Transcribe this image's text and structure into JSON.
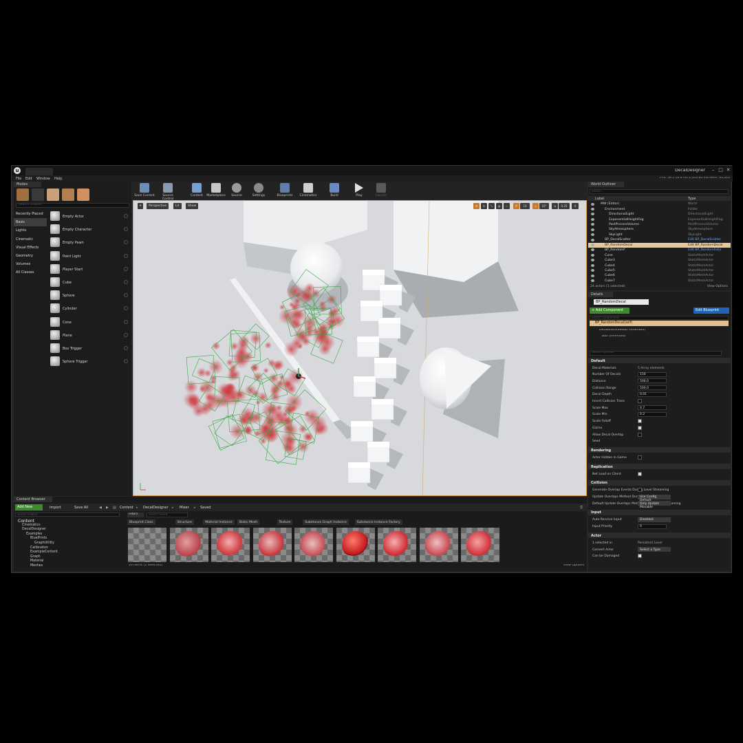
{
  "app": {
    "project_name": "DecalDesigner",
    "menu": [
      "File",
      "Edit",
      "Window",
      "Help"
    ],
    "stats": "FPS: 59.5    16.9 ms    2,103.84 mb    Mem: 93,343"
  },
  "modes": {
    "tab": "Modes",
    "search_placeholder": "Search Classes",
    "categories": [
      "Recently Placed",
      "Basic",
      "Lights",
      "Cinematic",
      "Visual Effects",
      "Geometry",
      "Volumes",
      "All Classes"
    ],
    "items": [
      "Empty Actor",
      "Empty Character",
      "Empty Pawn",
      "Point Light",
      "Player Start",
      "Cube",
      "Sphere",
      "Cylinder",
      "Cone",
      "Plane",
      "Box Trigger",
      "Sphere Trigger"
    ]
  },
  "toolbar": {
    "buttons": [
      "Save Current",
      "Source Control",
      "Content",
      "Marketplace",
      "Source",
      "Settings",
      "Blueprints",
      "Cinematics",
      "Build",
      "Play",
      "Launch"
    ]
  },
  "viewport": {
    "perspective": "Perspective",
    "lit": "Lit",
    "show": "Show",
    "grid_snap": "10",
    "rot_snap": "10°",
    "scale_snap": "0.25",
    "cam_speed": "4"
  },
  "outliner": {
    "tab": "World Outliner",
    "search_placeholder": "Search...",
    "col_label": "Label",
    "col_type": "Type",
    "rows": [
      {
        "name": "MW (Editor)",
        "type": "World",
        "indent": 1
      },
      {
        "name": "Environment",
        "type": "Folder",
        "indent": 2
      },
      {
        "name": "DirectionalLight",
        "type": "DirectionalLight",
        "indent": 3
      },
      {
        "name": "ExponentialHeightFog",
        "type": "ExponentialHeightFog",
        "indent": 3
      },
      {
        "name": "PostProcessVolume",
        "type": "PostProcessVolume",
        "indent": 3
      },
      {
        "name": "SkyAtmosphere",
        "type": "SkyAtmosphere",
        "indent": 3
      },
      {
        "name": "SkyLight",
        "type": "SkyLight",
        "indent": 3
      },
      {
        "name": "BP_DecalScatter",
        "type": "Edit BP_DecalScatter",
        "indent": 2,
        "link": true
      },
      {
        "name": "BP_RandomDecal",
        "type": "Edit BP_RandomDecal",
        "indent": 2,
        "link": true,
        "selected": true
      },
      {
        "name": "BP_RandomF",
        "type": "Edit BP_RandomFolia",
        "indent": 2,
        "link": true
      },
      {
        "name": "Cone",
        "type": "StaticMeshActor",
        "indent": 2
      },
      {
        "name": "Cube3",
        "type": "StaticMeshActor",
        "indent": 2
      },
      {
        "name": "Cube4",
        "type": "StaticMeshActor",
        "indent": 2
      },
      {
        "name": "Cube5",
        "type": "StaticMeshActor",
        "indent": 2
      },
      {
        "name": "Cube6",
        "type": "StaticMeshActor",
        "indent": 2
      },
      {
        "name": "Cube7",
        "type": "StaticMeshActor",
        "indent": 2
      }
    ],
    "footer": "24 actors (1 selected)",
    "view_options": "View Options"
  },
  "details": {
    "tab": "Details",
    "name_value": "BP_RandomDecal",
    "add_component": "+ Add Component",
    "edit_blueprint": "Edit Blueprint",
    "component_search": "Search Components",
    "self": "BP_RandomDecal(self)",
    "components": [
      "DefaultSceneRoot (Inherited)",
      "Box (Inherited)"
    ],
    "search_placeholder": "Search Details",
    "sections": {
      "default": "Default",
      "rendering": "Rendering",
      "replication": "Replication",
      "collision": "Collision",
      "input": "Input",
      "actor": "Actor"
    },
    "default_props": [
      {
        "label": "Decal Materials",
        "kind": "text",
        "value": "5 Array elements"
      },
      {
        "label": "Number Of Decals",
        "kind": "field",
        "value": "150"
      },
      {
        "label": "Distance",
        "kind": "field",
        "value": "500.0"
      },
      {
        "label": "Collision Range",
        "kind": "field",
        "value": "500.0"
      },
      {
        "label": "Decal Depth",
        "kind": "field",
        "value": "0.01"
      },
      {
        "label": "Invert Collision Trace",
        "kind": "check",
        "on": false
      },
      {
        "label": "Scale Max",
        "kind": "field",
        "value": "0.7"
      },
      {
        "label": "Scale Min",
        "kind": "field",
        "value": "0.2"
      },
      {
        "label": "Scale Falloff",
        "kind": "check",
        "on": true
      },
      {
        "label": "Gizmo",
        "kind": "check",
        "on": true
      },
      {
        "label": "Allow Decal Overlap",
        "kind": "check",
        "on": false
      },
      {
        "label": "Seed",
        "kind": "text",
        "value": ""
      }
    ],
    "rendering_props": [
      {
        "label": "Actor Hidden In Game",
        "kind": "check",
        "on": false
      }
    ],
    "replication_props": [
      {
        "label": "Net Load on Client",
        "kind": "check",
        "on": true
      }
    ],
    "collision_props": [
      {
        "label": "Generate Overlap Events During Level Streaming",
        "kind": "check",
        "on": false
      },
      {
        "label": "Update Overlaps Method During Level Streaming",
        "kind": "dropdown",
        "value": "Use Config Default"
      },
      {
        "label": "Default Update Overlaps Method During Level Streaming",
        "kind": "dropdown",
        "value": "Only Update Movable"
      }
    ],
    "input_props": [
      {
        "label": "Auto Receive Input",
        "kind": "dropdown",
        "value": "Disabled"
      },
      {
        "label": "Input Priority",
        "kind": "field",
        "value": "0"
      }
    ],
    "actor_props": [
      {
        "label": "1 selected in",
        "kind": "text",
        "value": "Persistent Level"
      },
      {
        "label": "Convert Actor",
        "kind": "dropdown",
        "value": "Select a Type"
      },
      {
        "label": "Can be Damaged",
        "kind": "check",
        "on": true
      }
    ]
  },
  "content_browser": {
    "tab": "Content Browser",
    "add_new": "Add New",
    "import": "Import",
    "save_all": "Save All",
    "path": [
      "Content",
      "DecalDesigner",
      "Mixer",
      "Saved"
    ],
    "tree_search": "Search Folders",
    "tree": [
      {
        "name": "Content",
        "indent": 0,
        "root": true
      },
      {
        "name": "Cinematics",
        "indent": 1
      },
      {
        "name": "DecalDesigner",
        "indent": 1
      },
      {
        "name": "Examples",
        "indent": 2
      },
      {
        "name": "BluePrints",
        "indent": 3
      },
      {
        "name": "GraphUtility",
        "indent": 4
      },
      {
        "name": "Calibration",
        "indent": 3
      },
      {
        "name": "ExampleContent",
        "indent": 3
      },
      {
        "name": "Graph",
        "indent": 3
      },
      {
        "name": "Material",
        "indent": 3
      },
      {
        "name": "Meshes",
        "indent": 3
      }
    ],
    "filters": "Filters",
    "asset_search": "Search Saved",
    "filter_chips": [
      "Blueprint Class",
      "Structure",
      "Material Instance",
      "Static Mesh",
      "Texture",
      "Substance Graph Instance",
      "Substance Instance Factory"
    ],
    "item_count": "19 items (1 selected)",
    "view_options": "View Options"
  }
}
